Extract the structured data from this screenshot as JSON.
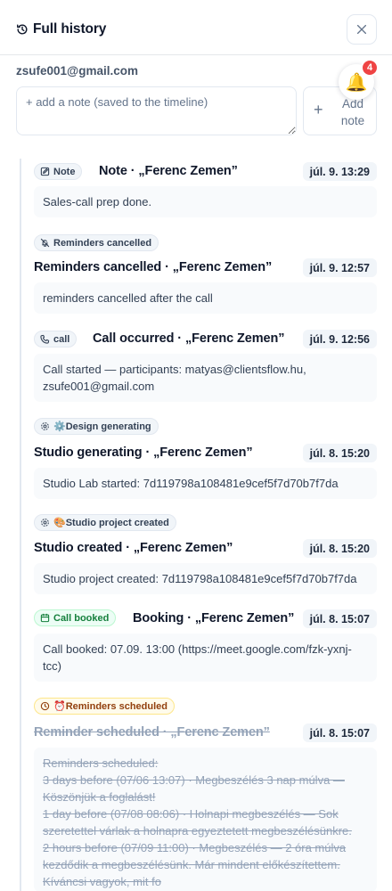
{
  "header": {
    "title": "Full history",
    "history_icon": "history-icon",
    "close_icon": "close-icon"
  },
  "contact": {
    "email": "zsufe001@gmail.com"
  },
  "notifications": {
    "icon": "bell-icon",
    "count": "4"
  },
  "note": {
    "placeholder": "+ add a note (saved to the timeline)",
    "value": ""
  },
  "add_note_button": {
    "icon": "plus-icon",
    "label_line1": "Add",
    "label_line2": "note"
  },
  "colors": {
    "accent_green": "#15803d",
    "badge_red": "#ef4444",
    "amber": "#92400e"
  },
  "entries": [
    {
      "pill": "Note",
      "pill_icon": "edit-icon",
      "title": "Note · „Ferenc Zemen”",
      "date": "júl. 9. 13:29",
      "body": [
        "Sales-call prep done."
      ]
    },
    {
      "pill": "Reminders cancelled",
      "pill_icon": "bell-off-icon",
      "title": "Reminders cancelled · „Ferenc Zemen”",
      "date": "júl. 9. 12:57",
      "body": [
        "reminders cancelled after the call"
      ]
    },
    {
      "pill": "call",
      "pill_icon": "phone-icon",
      "title": "Call occurred · „Ferenc Zemen”",
      "date": "júl. 9. 12:56",
      "body": [
        "Call started — participants: matyas@clientsflow.hu,",
        "zsufe001@gmail.com"
      ]
    },
    {
      "pill": "⚙️Design generating",
      "pill_icon": "gear-icon",
      "title": "Studio generating · „Ferenc Zemen”",
      "date": "júl. 8. 15:20",
      "body": [
        "Studio Lab started: 7d119798a108481e9cef5f7d70b7f7da"
      ]
    },
    {
      "pill": "🎨Studio project created",
      "pill_icon": "gear-icon",
      "title": "Studio created · „Ferenc Zemen”",
      "date": "júl. 8. 15:20",
      "body": [
        "Studio project created: 7d119798a108481e9cef5f7d70b7f7da"
      ]
    },
    {
      "pill": "Call booked",
      "pill_icon": "calendar-icon",
      "title": "Booking · „Ferenc Zemen”",
      "date": "júl. 8. 15:07",
      "body": [
        "Call booked: 07.09. 13:00 (https://meet.google.com/fzk-yxnj-",
        "tcc)"
      ]
    },
    {
      "pill": "⏰Reminders scheduled",
      "pill_icon": "clock-icon",
      "title": "Reminder scheduled · „Ferenc Zemen”",
      "date": "júl. 8. 15:07",
      "body": [
        "Reminders scheduled:",
        "3 days before (07/06 13:07) · Megbeszélés 3 nap múlva —",
        "Köszönjük a foglalást!",
        "1 day before (07/08 08:06) · Holnapi megbeszélés — Sok",
        "szeretettel várlak a holnapra egyeztetett megbeszélésünkre.",
        "2 hours before (07/09 11:00) · Megbeszélés — 2 óra múlva",
        "kezdődik a megbeszélésünk. Már mindent előkészítettem.",
        "Kíváncsi vagyok, mit fo"
      ]
    }
  ]
}
